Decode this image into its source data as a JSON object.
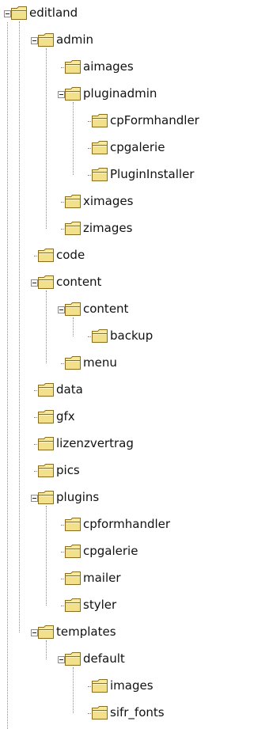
{
  "tree": {
    "nodes": [
      {
        "label": "editland",
        "depth": 0,
        "expanded": true,
        "last": true
      },
      {
        "label": "admin",
        "depth": 1,
        "expanded": true,
        "last": false
      },
      {
        "label": "aimages",
        "depth": 2,
        "expanded": false,
        "last": false
      },
      {
        "label": "pluginadmin",
        "depth": 2,
        "expanded": true,
        "last": false
      },
      {
        "label": "cpFormhandler",
        "depth": 3,
        "expanded": false,
        "last": false
      },
      {
        "label": "cpgalerie",
        "depth": 3,
        "expanded": false,
        "last": false
      },
      {
        "label": "PluginInstaller",
        "depth": 3,
        "expanded": false,
        "last": true
      },
      {
        "label": "ximages",
        "depth": 2,
        "expanded": false,
        "last": false
      },
      {
        "label": "zimages",
        "depth": 2,
        "expanded": false,
        "last": true
      },
      {
        "label": "code",
        "depth": 1,
        "expanded": false,
        "last": false
      },
      {
        "label": "content",
        "depth": 1,
        "expanded": true,
        "last": false
      },
      {
        "label": "content",
        "depth": 2,
        "expanded": true,
        "last": false
      },
      {
        "label": "backup",
        "depth": 3,
        "expanded": false,
        "last": true
      },
      {
        "label": "menu",
        "depth": 2,
        "expanded": false,
        "last": true
      },
      {
        "label": "data",
        "depth": 1,
        "expanded": false,
        "last": false
      },
      {
        "label": "gfx",
        "depth": 1,
        "expanded": false,
        "last": false
      },
      {
        "label": "lizenzvertrag",
        "depth": 1,
        "expanded": false,
        "last": false
      },
      {
        "label": "pics",
        "depth": 1,
        "expanded": false,
        "last": false
      },
      {
        "label": "plugins",
        "depth": 1,
        "expanded": true,
        "last": false
      },
      {
        "label": "cpformhandler",
        "depth": 2,
        "expanded": false,
        "last": false
      },
      {
        "label": "cpgalerie",
        "depth": 2,
        "expanded": false,
        "last": false
      },
      {
        "label": "mailer",
        "depth": 2,
        "expanded": false,
        "last": false
      },
      {
        "label": "styler",
        "depth": 2,
        "expanded": false,
        "last": true
      },
      {
        "label": "templates",
        "depth": 1,
        "expanded": true,
        "last": false
      },
      {
        "label": "default",
        "depth": 2,
        "expanded": true,
        "last": true
      },
      {
        "label": "images",
        "depth": 3,
        "expanded": false,
        "last": false
      },
      {
        "label": "sifr_fonts",
        "depth": 3,
        "expanded": false,
        "last": true
      }
    ],
    "colors": {
      "folder_fill": "#f3e08b",
      "folder_tab": "#f7ea9c",
      "folder_outline": "#8a6d1f",
      "guide_line": "#8e8e8e",
      "text": "#111111"
    },
    "icons": {
      "folder": "folder-icon",
      "collapse": "collapse-toggle-icon"
    }
  }
}
